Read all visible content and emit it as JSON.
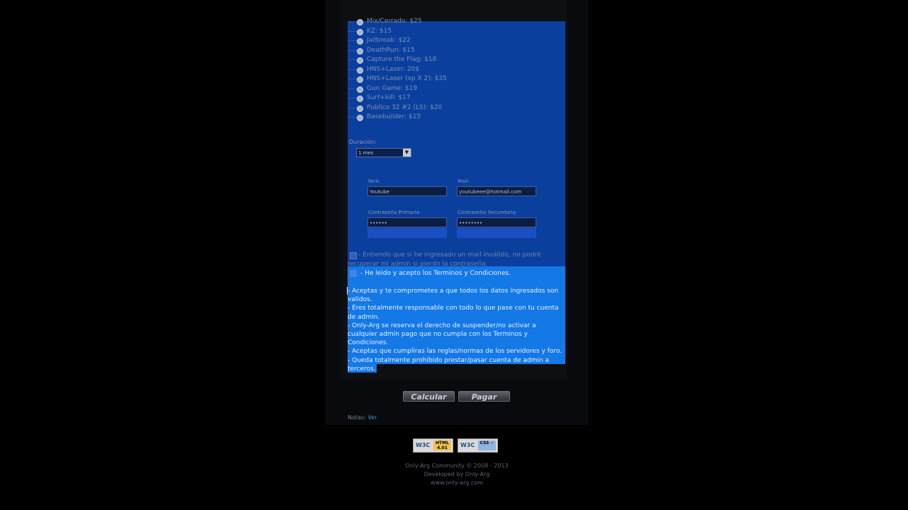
{
  "servers": [
    "Mix/Cerrado: $25",
    "KZ: $15",
    "Jailbreak: $22",
    "DeathRun: $15",
    "Capture the Flag: $18",
    "HNS+Laser: 20$",
    "HNS+Laser (xp X 2): $35",
    "Gun Game: $19",
    "Surf+kill: $17",
    "Publico 32 #2 (LS): $20",
    "Basebuilder: $15"
  ],
  "duration": {
    "label": "Duración:",
    "selected": "1 mes"
  },
  "form": {
    "nick_label": "Nick:",
    "nick_value": "Youtube",
    "mail_label": "Mail:",
    "mail_value": "youtubeee@hotmail.com",
    "pass1_label": "Contraseña Primaria:",
    "pass1_value": "••••••",
    "pass2_label": "Contraseña Secundaria:",
    "pass2_value": "••••••••"
  },
  "agreements": {
    "mail_notice": "- Entiendo que si he ingresado un mail inválido, no podré recuperar mi admin si pierdo la contraseña.",
    "accept_terms": "- He leido y acepto los Terminos y Condiciones."
  },
  "terms": [
    "- Aceptas y te comprometes a que todos los datos ingresados son validos.",
    "- Eres totalmente responsable con todo lo que pase con tu cuenta de admin.",
    "- Only-Arg se reserva el derecho de suspender/no activar a cualquier admin pago que no cumpla con los Terminos y Condiciones.",
    "- Aceptas que cumpliras las reglas/normas de los servidores y foro.",
    "- Queda totalmente prohibido prestar/pasar cuenta de admin a terceros."
  ],
  "buttons": {
    "calculate": "Calcular",
    "pay": "Pagar"
  },
  "notes": {
    "label": "Notas:",
    "link": "Ver"
  },
  "badges": {
    "w3c_html": "W3C",
    "w3c_html_tag": "HTML 4.01",
    "w3c_css": "W3C",
    "w3c_css_tag": "CSS ✓"
  },
  "footer": {
    "line1": "Only-Arg Community © 2008 - 2013",
    "line2": "Developed by Only-Arg",
    "line3": "www.only-arg.com"
  },
  "colors": {
    "selection_inactive": "#0a3f9e",
    "selection_active": "#1478e6",
    "background": "#000000"
  }
}
